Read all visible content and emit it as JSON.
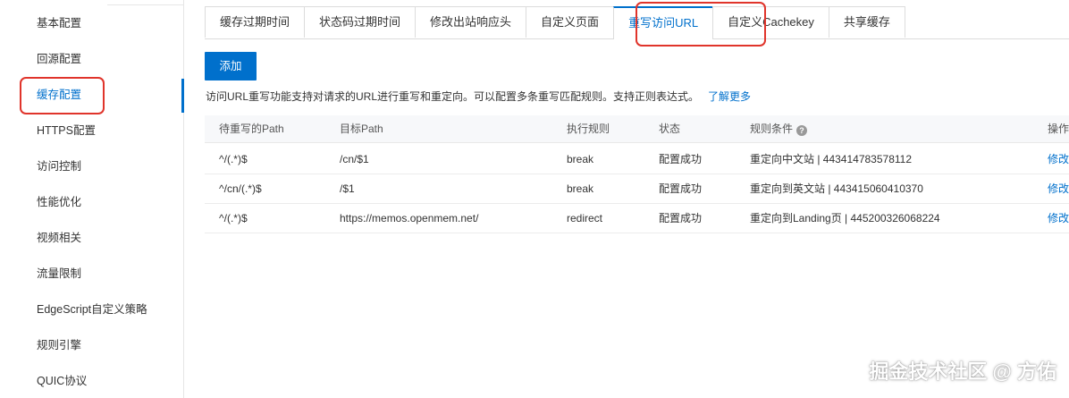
{
  "sidebar": {
    "items": [
      {
        "label": "基本配置"
      },
      {
        "label": "回源配置"
      },
      {
        "label": "缓存配置"
      },
      {
        "label": "HTTPS配置"
      },
      {
        "label": "访问控制"
      },
      {
        "label": "性能优化"
      },
      {
        "label": "视频相关"
      },
      {
        "label": "流量限制"
      },
      {
        "label": "EdgeScript自定义策略"
      },
      {
        "label": "规则引擎"
      },
      {
        "label": "QUIC协议"
      }
    ],
    "active_index": 2
  },
  "tabs": [
    {
      "label": "缓存过期时间"
    },
    {
      "label": "状态码过期时间"
    },
    {
      "label": "修改出站响应头"
    },
    {
      "label": "自定义页面"
    },
    {
      "label": "重写访问URL"
    },
    {
      "label": "自定义Cachekey"
    },
    {
      "label": "共享缓存"
    }
  ],
  "active_tab_index": 4,
  "toolbar": {
    "add_label": "添加"
  },
  "description": {
    "text": "访问URL重写功能支持对请求的URL进行重写和重定向。可以配置多条重写匹配规则。支持正则表达式。",
    "link": "了解更多"
  },
  "table": {
    "headers": [
      "待重写的Path",
      "目标Path",
      "执行规则",
      "状态",
      "规则条件",
      "操作"
    ],
    "rows": [
      {
        "source": "^/(.*)$",
        "target": "/cn/$1",
        "rule": "break",
        "status": "配置成功",
        "condition": "重定向中文站 | 443414783578112",
        "action": "修改"
      },
      {
        "source": "^/cn/(.*)$",
        "target": "/$1",
        "rule": "break",
        "status": "配置成功",
        "condition": "重定向到英文站 | 443415060410370",
        "action": "修改"
      },
      {
        "source": "^/(.*)$",
        "target": "https://memos.openmem.net/",
        "rule": "redirect",
        "status": "配置成功",
        "condition": "重定向到Landing页 | 445200326068224",
        "action": "修改"
      }
    ]
  },
  "watermark": "掘金技术社区 @ 方佑",
  "colors": {
    "accent": "#0070cc",
    "highlight_box": "#e0342b"
  }
}
